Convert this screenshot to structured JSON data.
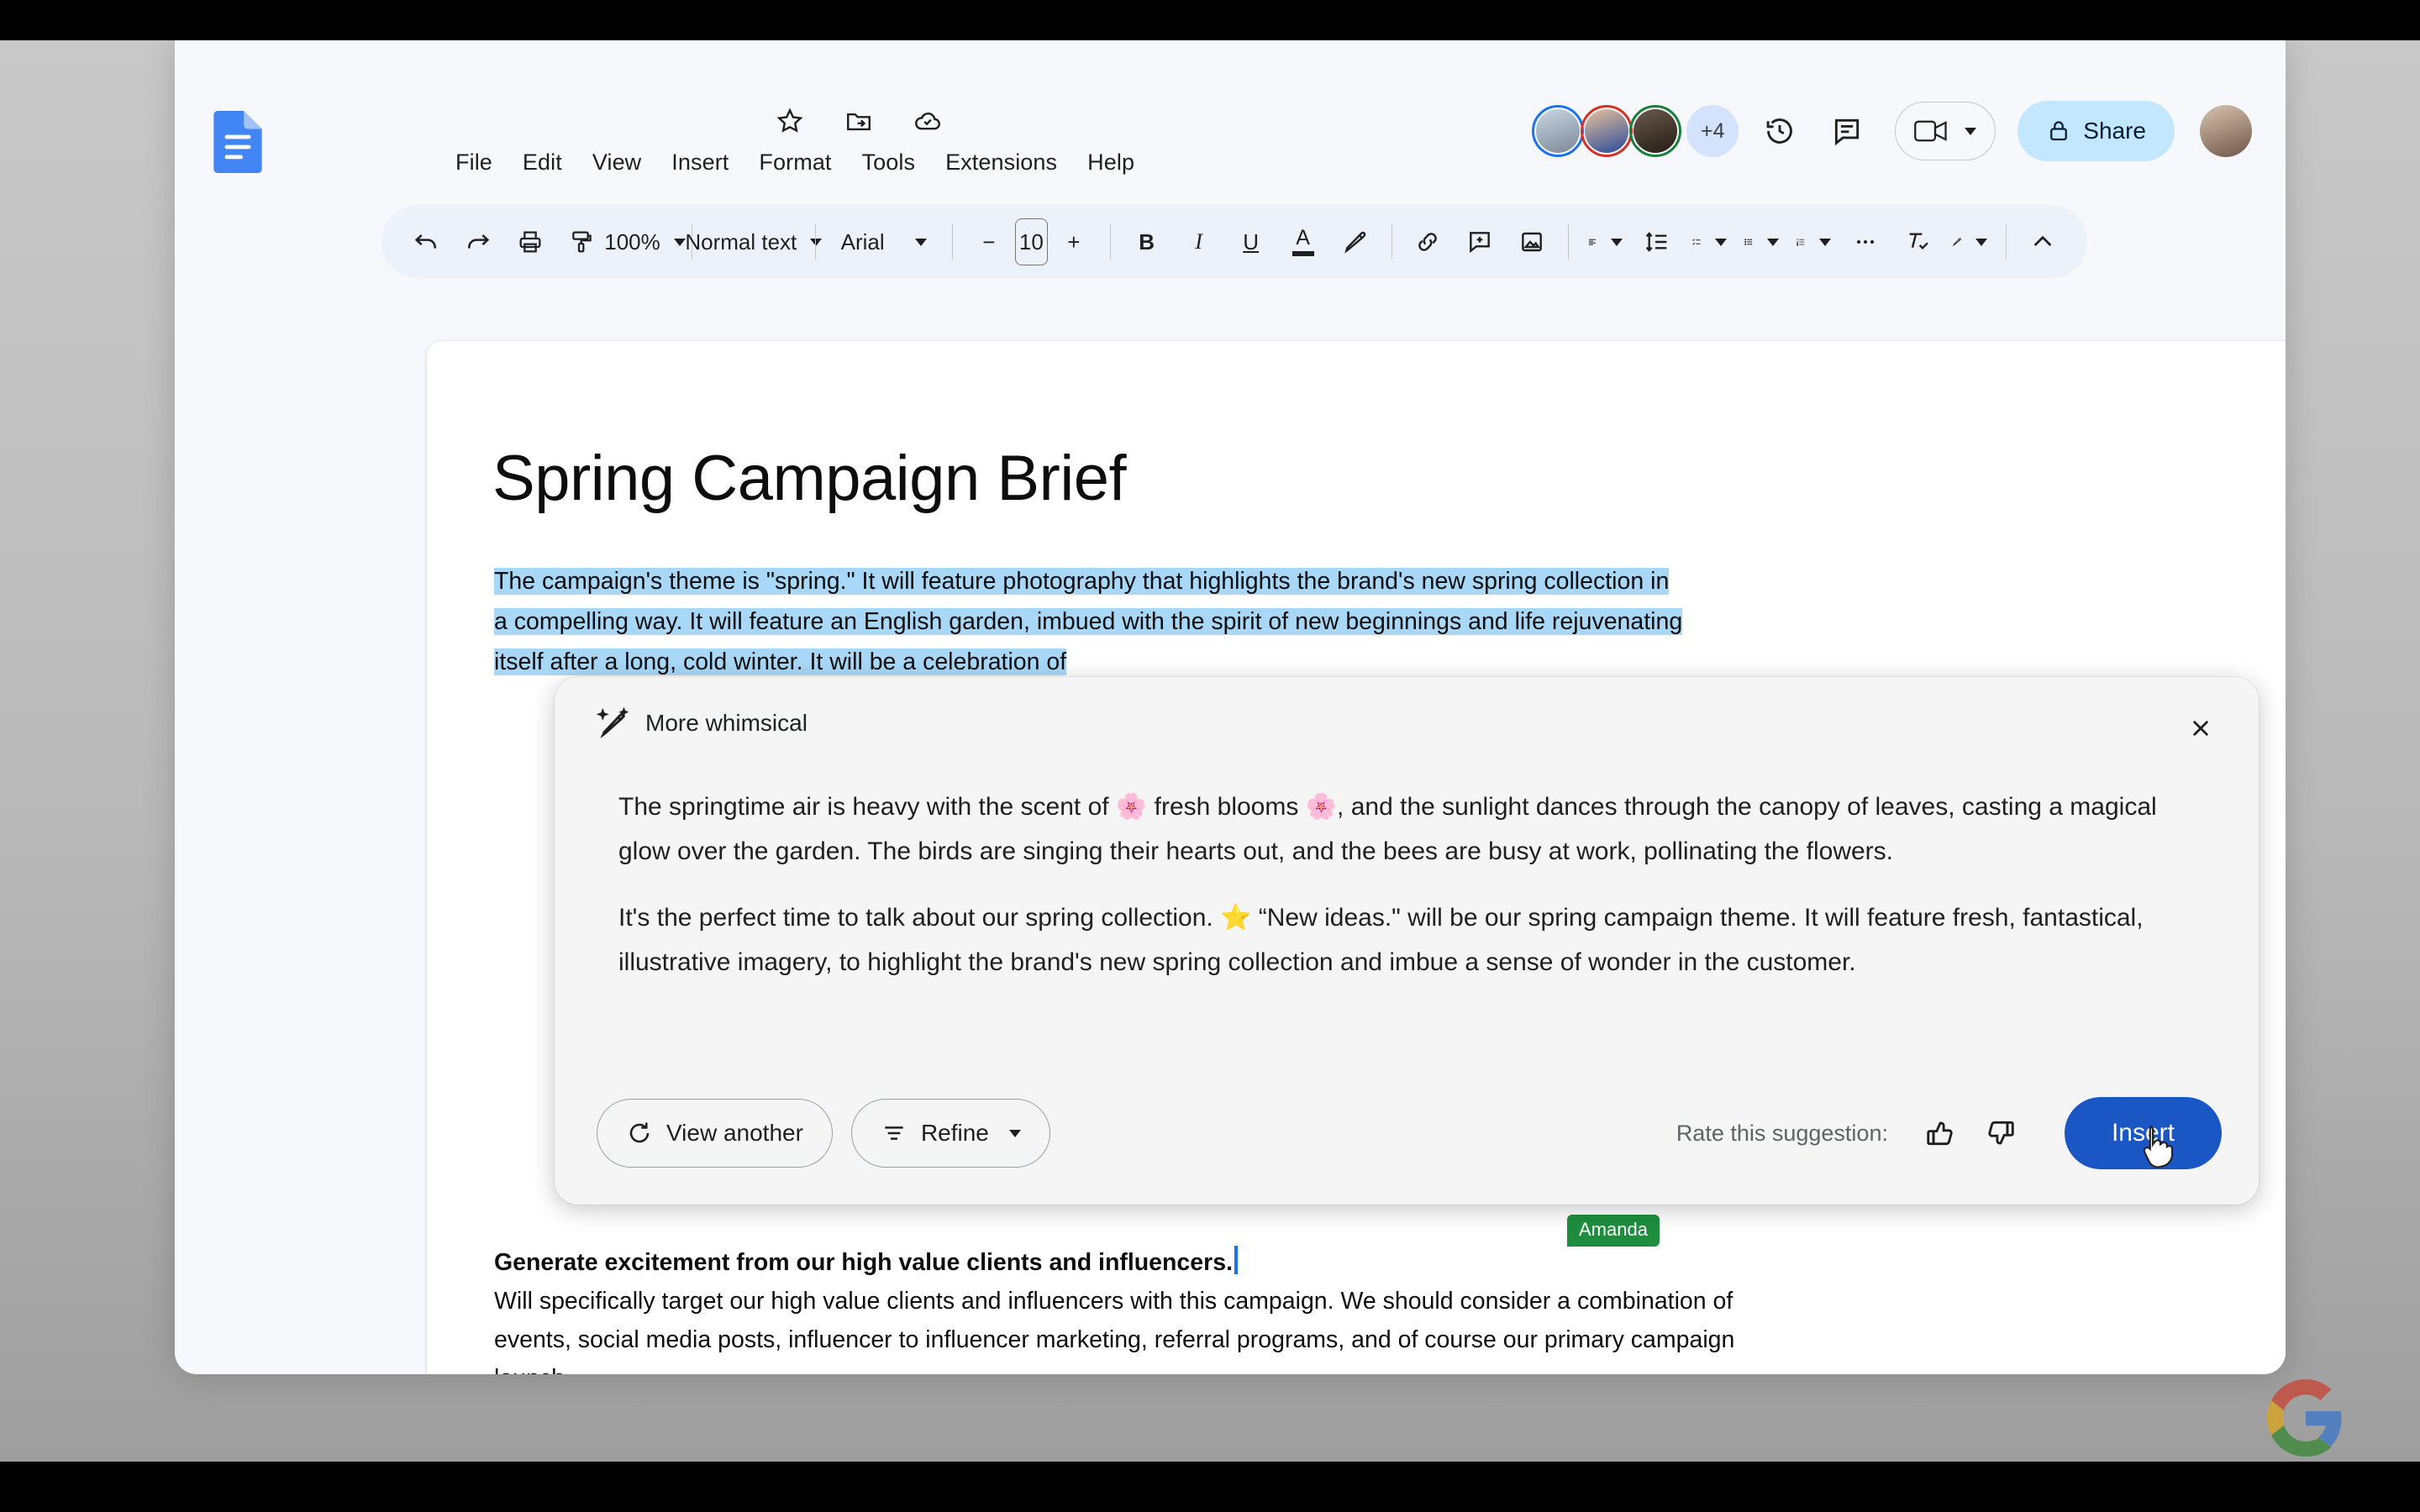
{
  "app": {
    "logo_icon": "google-docs-icon",
    "menu": [
      "File",
      "Edit",
      "View",
      "Insert",
      "Format",
      "Tools",
      "Extensions",
      "Help"
    ],
    "quick_icons": [
      "star-icon",
      "move-to-folder-icon",
      "cloud-saved-icon"
    ]
  },
  "topbar": {
    "collaborators_overflow": "+4",
    "history_icon": "version-history-icon",
    "comment_icon": "comment-history-icon",
    "meet_icon": "meet-camera-icon",
    "meet_caret": "chevron-down-icon",
    "share_label": "Share",
    "share_lock_icon": "lock-icon",
    "account_icon": "account-avatar",
    "avatars": [
      {
        "name": "collaborator-1",
        "ring": "#1a73e8"
      },
      {
        "name": "collaborator-2",
        "ring": "#d93025"
      },
      {
        "name": "collaborator-3",
        "ring": "#188038"
      }
    ]
  },
  "toolbar": {
    "undo": "undo-icon",
    "redo": "redo-icon",
    "print": "print-icon",
    "paint_format": "paint-format-icon",
    "zoom_value": "100%",
    "style_value": "Normal text",
    "font_value": "Arial",
    "font_size_decrease": "−",
    "font_size_value": "10",
    "font_size_increase": "+",
    "bold": "B",
    "italic": "I",
    "underline": "U",
    "text_color": "A",
    "highlight": "highlighter-icon",
    "link": "insert-link-icon",
    "comment": "add-comment-icon",
    "image": "insert-image-icon",
    "align": "align-left-icon",
    "line_spacing": "line-spacing-icon",
    "checklist": "checklist-icon",
    "bulleted_list": "bulleted-list-icon",
    "numbered_list": "numbered-list-icon",
    "more": "more-options-icon",
    "clear_formatting": "clear-formatting-icon",
    "editing_mode": "editing-mode-pencil-icon",
    "collapse": "collapse-toolbar-icon"
  },
  "document": {
    "title": "Spring Campaign Brief",
    "highlighted_paragraph": "The campaign's theme is \"spring.\" It will feature photography that highlights the brand's new spring collection in a compelling way. It will feature an English garden, imbued with the spirit of new beginnings and life rejuvenating itself after a long, cold winter. It will be a celebration of",
    "bottom_heading": "Generate excitement from our high value clients and influencers.",
    "bottom_paragraph": "Will specifically target our high value clients and influencers with this campaign. We should consider a combination of events, social media posts, influencer to influencer marketing, referral programs, and of course our primary campaign launch.",
    "collaborator_tag": "Amanda",
    "highlight_color": "#a8d7f7",
    "tag_color": "#1e8e3e"
  },
  "ai_card": {
    "icon": "magic-wand-icon",
    "title": "More whimsical",
    "close_icon": "close-icon",
    "paragraphs": [
      "The springtime air is heavy with the scent of 🌸 fresh blooms 🌸, and the sunlight dances through the canopy of leaves, casting a magical glow over the garden. The birds are singing their hearts out, and the bees are busy at work, pollinating the flowers.",
      "It's the perfect time to talk about our spring collection. ⭐ “New ideas.\" will be our spring campaign theme. It will feature fresh, fantastical, illustrative imagery, to highlight the brand's new spring collection and imbue a sense of wonder in the customer."
    ],
    "view_another_label": "View another",
    "view_another_icon": "refresh-icon",
    "refine_label": "Refine",
    "refine_icon": "tune-icon",
    "refine_caret": "chevron-down-icon",
    "rate_label": "Rate this suggestion:",
    "thumb_up_icon": "thumb-up-icon",
    "thumb_down_icon": "thumb-down-icon",
    "insert_label": "Insert",
    "insert_color": "#1a56c4"
  },
  "watermark": {
    "icon": "google-g-logo"
  }
}
